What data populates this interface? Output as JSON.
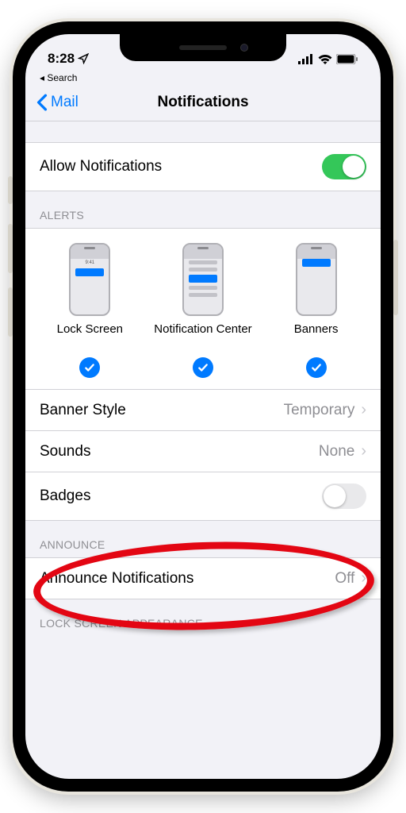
{
  "status": {
    "time": "8:28",
    "back_app": "◂ Search"
  },
  "nav": {
    "back_label": "Mail",
    "title": "Notifications"
  },
  "allow": {
    "label": "Allow Notifications",
    "on": true
  },
  "alerts": {
    "header": "ALERTS",
    "items": [
      {
        "label": "Lock Screen",
        "checked": true
      },
      {
        "label": "Notification Center",
        "checked": true
      },
      {
        "label": "Banners",
        "checked": true
      }
    ]
  },
  "banner_style": {
    "label": "Banner Style",
    "value": "Temporary"
  },
  "sounds": {
    "label": "Sounds",
    "value": "None"
  },
  "badges": {
    "label": "Badges",
    "on": false
  },
  "announce": {
    "header": "ANNOUNCE",
    "label": "Announce Notifications",
    "value": "Off"
  },
  "lock_appearance_header": "LOCK SCREEN APPEARANCE",
  "mini_time": "9:41"
}
